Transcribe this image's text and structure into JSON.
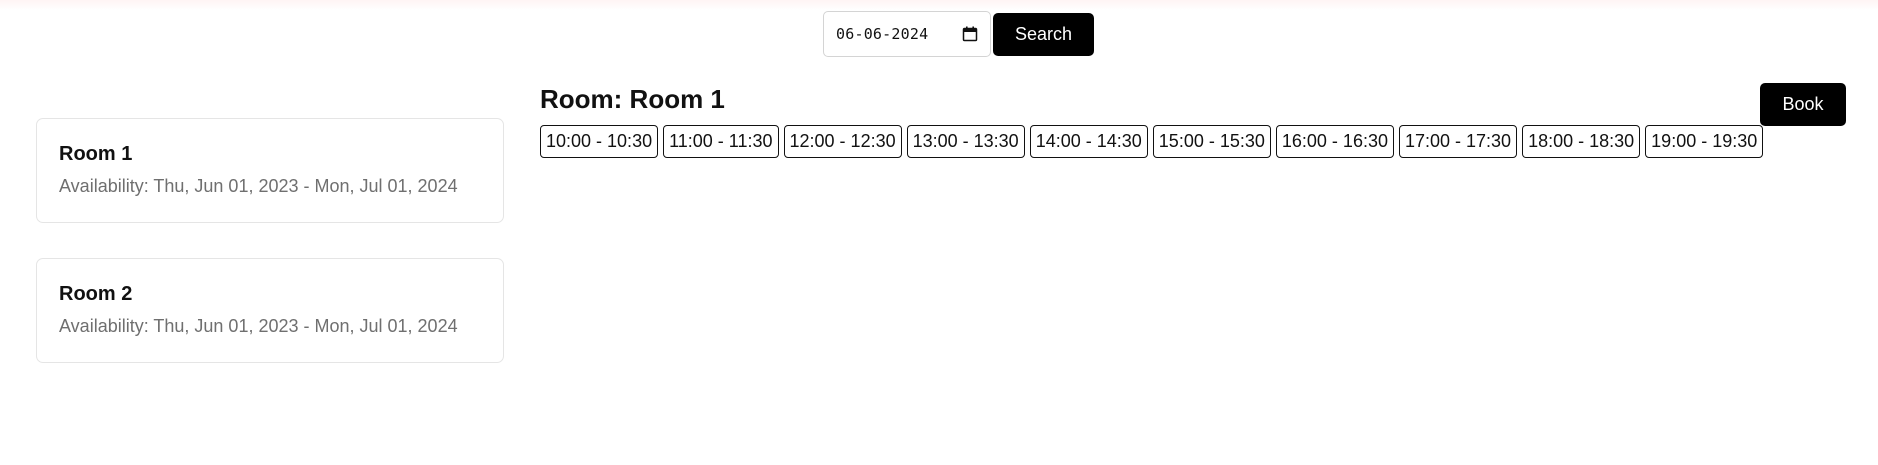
{
  "search": {
    "date_value": "06-06-2024",
    "calendar_icon": "calendar-icon",
    "button_label": "Search"
  },
  "rooms": [
    {
      "name": "Room 1",
      "availability": "Availability: Thu, Jun 01, 2023 - Mon, Jul 01, 2024"
    },
    {
      "name": "Room 2",
      "availability": "Availability: Thu, Jun 01, 2023 - Mon, Jul 01, 2024"
    }
  ],
  "detail": {
    "title": "Room: Room 1",
    "book_label": "Book",
    "slots": [
      "10:00 - 10:30",
      "11:00 - 11:30",
      "12:00 - 12:30",
      "13:00 - 13:30",
      "14:00 - 14:30",
      "15:00 - 15:30",
      "16:00 - 16:30",
      "17:00 - 17:30",
      "18:00 - 18:30",
      "19:00 - 19:30"
    ]
  },
  "colors": {
    "button_bg": "#000000",
    "button_text": "#ffffff",
    "muted_text": "#6f6f6f",
    "card_border": "#e5e5e5"
  }
}
